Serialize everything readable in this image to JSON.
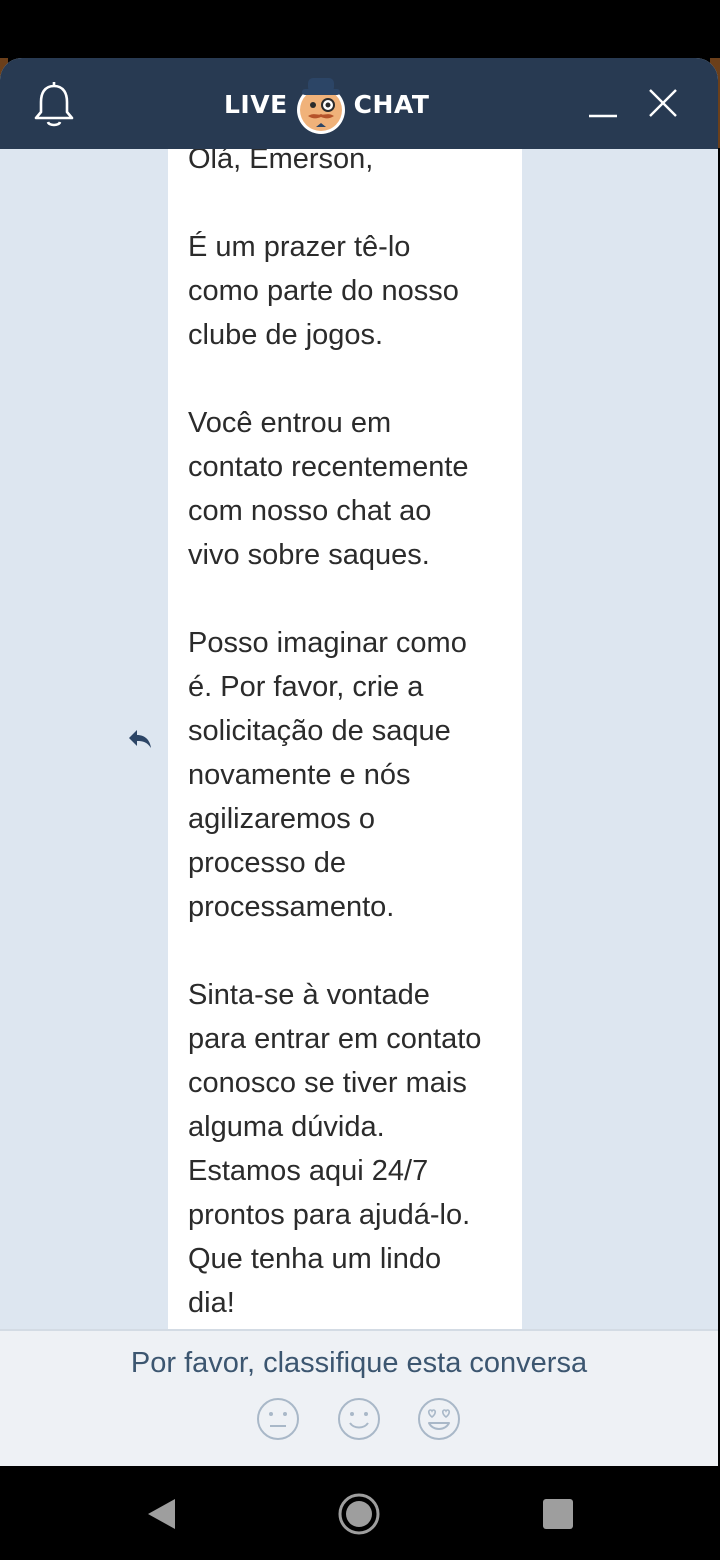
{
  "header": {
    "logo_left": "LIVE",
    "logo_right": "CHAT",
    "icons": [
      "bell-icon",
      "minimize-icon",
      "close-icon"
    ]
  },
  "conversation": {
    "message": "Olá, Emerson,\n\nÉ um prazer tê-lo\ncomo parte do nosso\nclube de jogos.\n\nVocê entrou em\ncontato recentemente\ncom nosso chat ao\nvivo sobre saques.\n\nPosso imaginar como\né. Por favor, crie a\nsolicitação de saque\nnovamente e nós\nagilizaremos o\nprocesso de\nprocessamento.\n\nSinta-se à vontade\npara entrar em contato\nconosco se tiver mais\nalguma dúvida.\nEstamos aqui 24/7\nprontos para ajudá-lo.\nQue tenha um lindo\ndia!",
    "reply_icon": "reply-icon"
  },
  "rating": {
    "prompt": "Por favor, classifique esta conversa",
    "options": [
      "neutral-face-icon",
      "smile-face-icon",
      "heart-eyes-face-icon"
    ]
  },
  "colors": {
    "header_bg": "#283a52",
    "chat_bg": "#dde6f0",
    "rating_text": "#3c5670"
  },
  "system_nav": [
    "back-icon",
    "home-icon",
    "recents-icon"
  ]
}
